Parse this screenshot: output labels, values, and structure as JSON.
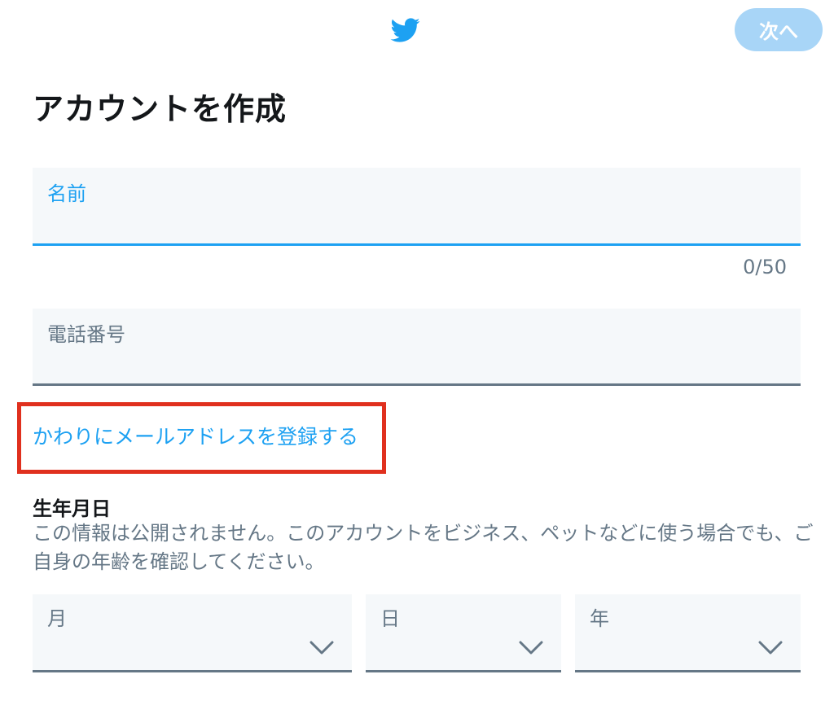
{
  "header": {
    "logo_icon": "twitter-bird-icon",
    "next_label": "次へ",
    "brand_color": "#1da1f2",
    "next_button_color": "#a8d5f7"
  },
  "title": "アカウントを作成",
  "name_field": {
    "label": "名前",
    "value": "",
    "counter": "0/50"
  },
  "phone_field": {
    "label": "電話番号",
    "value": ""
  },
  "email_link": {
    "label": "かわりにメールアドレスを登録する",
    "highlight_color": "#e0301e"
  },
  "dob": {
    "title": "生年月日",
    "description": "この情報は公開されません。このアカウントをビジネス、ペットなどに使う場合でも、ご自身の年齢を確認してください。",
    "month_label": "月",
    "day_label": "日",
    "year_label": "年",
    "chevron_icon": "chevron-down-icon"
  }
}
